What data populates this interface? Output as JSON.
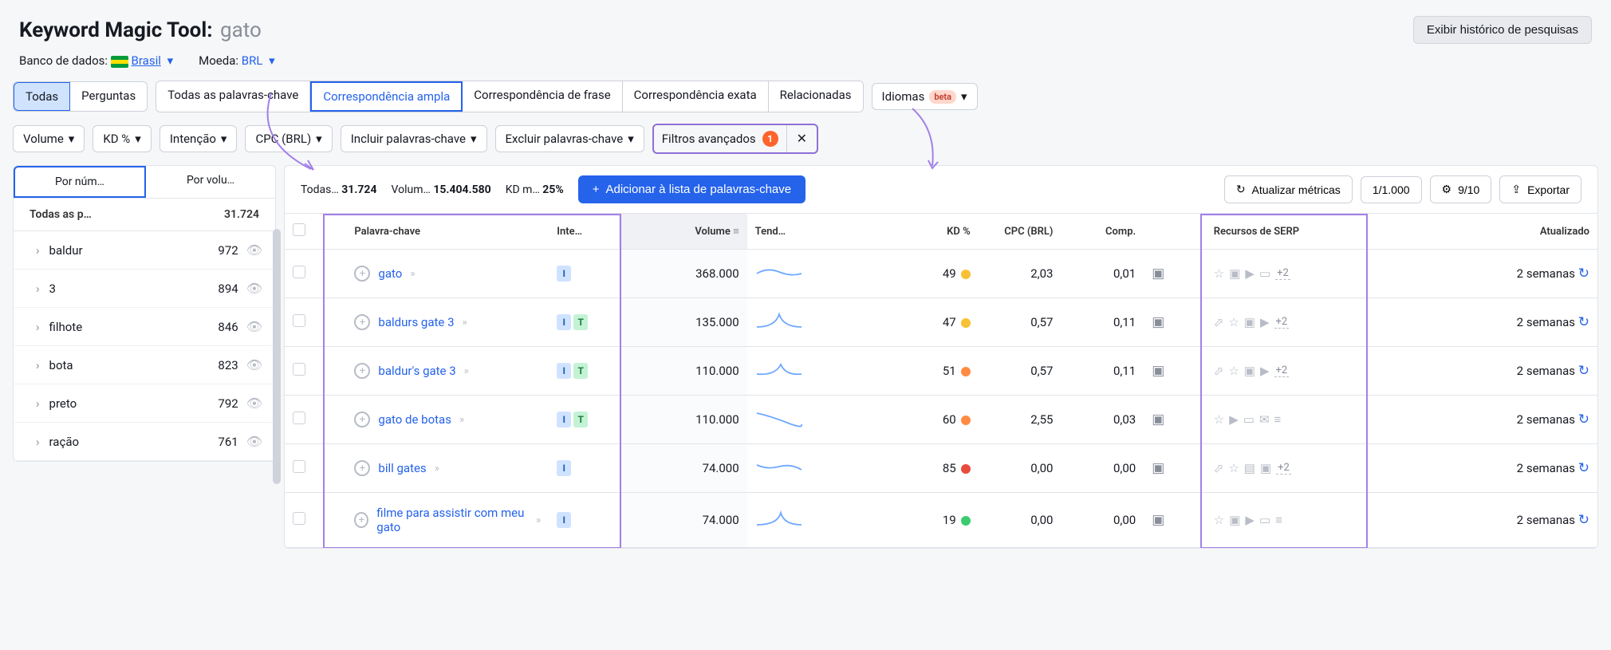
{
  "header": {
    "tool_name": "Keyword Magic Tool:",
    "keyword": "gato",
    "history_btn": "Exibir histórico de pesquisas",
    "db_label": "Banco de dados:",
    "db_value": "Brasil",
    "currency_label": "Moeda:",
    "currency_value": "BRL"
  },
  "tabs1": {
    "todas": "Todas",
    "perguntas": "Perguntas"
  },
  "tabs2": {
    "all": "Todas as palavras-chave",
    "broad": "Correspondência ampla",
    "phrase": "Correspondência de frase",
    "exact": "Correspondência exata",
    "related": "Relacionadas"
  },
  "lang": {
    "label": "Idiomas",
    "badge": "beta"
  },
  "filters": {
    "volume": "Volume",
    "kd": "KD %",
    "intent": "Intenção",
    "cpc": "CPC (BRL)",
    "include": "Incluir palavras-chave",
    "exclude": "Excluir palavras-chave",
    "advanced": "Filtros avançados",
    "advanced_count": "1"
  },
  "sidebar": {
    "tab1": "Por núm…",
    "tab2": "Por volu…",
    "head_label": "Todas as p…",
    "head_count": "31.724",
    "items": [
      {
        "name": "baldur",
        "count": "972"
      },
      {
        "name": "3",
        "count": "894"
      },
      {
        "name": "filhote",
        "count": "846"
      },
      {
        "name": "bota",
        "count": "823"
      },
      {
        "name": "preto",
        "count": "792"
      },
      {
        "name": "ração",
        "count": "761"
      }
    ]
  },
  "stats": {
    "s1_label": "Todas…",
    "s1_val": "31.724",
    "s2_label": "Volum…",
    "s2_val": "15.404.580",
    "s3_label": "KD m…",
    "s3_val": "25%",
    "add_btn": "Adicionar à lista de palavras-chave",
    "refresh": "Atualizar métricas",
    "pos": "1/1.000",
    "count": "9/10",
    "export": "Exportar"
  },
  "cols": {
    "kw": "Palavra-chave",
    "intent": "Inte…",
    "volume": "Volume",
    "trend": "Tend…",
    "kd": "KD %",
    "cpc": "CPC (BRL)",
    "comp": "Comp.",
    "serp": "Recursos de SERP",
    "updated": "Atualizado"
  },
  "rows": [
    {
      "kw": "gato",
      "intents": [
        "I"
      ],
      "volume": "368.000",
      "kd": "49",
      "kd_c": "yellow",
      "cpc": "2,03",
      "comp": "0,01",
      "serp_more": "+2",
      "updated": "2 semanas"
    },
    {
      "kw": "baldurs gate 3",
      "intents": [
        "I",
        "T"
      ],
      "volume": "135.000",
      "kd": "47",
      "kd_c": "yellow",
      "cpc": "0,57",
      "comp": "0,11",
      "serp_more": "+2",
      "updated": "2 semanas"
    },
    {
      "kw": "baldur's gate 3",
      "intents": [
        "I",
        "T"
      ],
      "volume": "110.000",
      "kd": "51",
      "kd_c": "orange",
      "cpc": "0,57",
      "comp": "0,11",
      "serp_more": "+2",
      "updated": "2 semanas"
    },
    {
      "kw": "gato de botas",
      "intents": [
        "I",
        "T"
      ],
      "volume": "110.000",
      "kd": "60",
      "kd_c": "orange",
      "cpc": "2,55",
      "comp": "0,03",
      "serp_more": "",
      "updated": "2 semanas"
    },
    {
      "kw": "bill gates",
      "intents": [
        "I"
      ],
      "volume": "74.000",
      "kd": "85",
      "kd_c": "red",
      "cpc": "0,00",
      "comp": "0,00",
      "serp_more": "+2",
      "updated": "2 semanas"
    },
    {
      "kw": "filme para assistir com meu gato",
      "intents": [
        "I"
      ],
      "volume": "74.000",
      "kd": "19",
      "kd_c": "green",
      "cpc": "0,00",
      "comp": "0,00",
      "serp_more": "",
      "updated": "2 semanas"
    }
  ]
}
